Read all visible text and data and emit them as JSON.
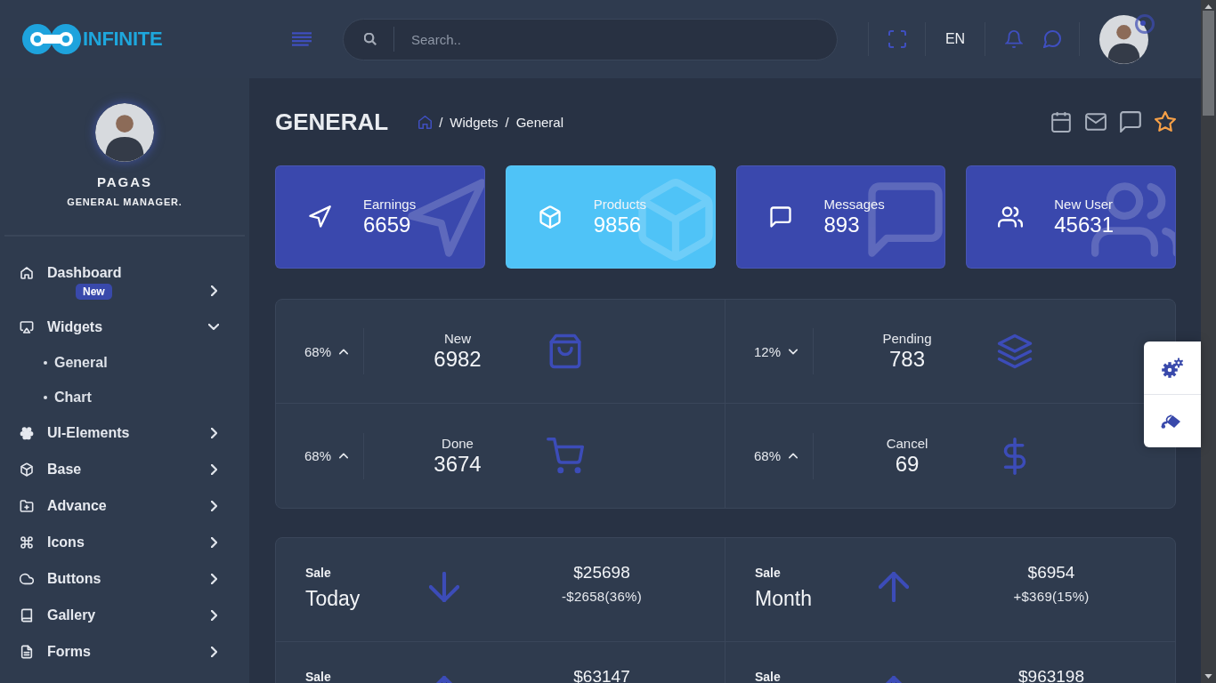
{
  "header": {
    "brand": "INFINITE",
    "search": {
      "placeholder": "Search.."
    },
    "language": "EN"
  },
  "sidebar": {
    "profile": {
      "name": "PAGAS",
      "role": "GENERAL MANAGER."
    },
    "items": [
      {
        "label": "Dashboard",
        "badge": "New",
        "expanded": false
      },
      {
        "label": "Widgets",
        "expanded": true,
        "children": [
          {
            "label": "General"
          },
          {
            "label": "Chart"
          }
        ]
      },
      {
        "label": "UI-Elements",
        "expanded": false
      },
      {
        "label": "Base",
        "expanded": false
      },
      {
        "label": "Advance",
        "expanded": false
      },
      {
        "label": "Icons",
        "expanded": false
      },
      {
        "label": "Buttons",
        "expanded": false
      },
      {
        "label": "Gallery",
        "expanded": false
      },
      {
        "label": "Forms",
        "expanded": false
      }
    ]
  },
  "page": {
    "title": "GENERAL",
    "breadcrumb": [
      {
        "separator": "/",
        "label": "Widgets"
      },
      {
        "separator": "/",
        "label": "General"
      }
    ]
  },
  "stats": [
    {
      "label": "Earnings",
      "value": "6659",
      "color": "#3a48ad"
    },
    {
      "label": "Products",
      "value": "9856",
      "color": "#4fc3f7"
    },
    {
      "label": "Messages",
      "value": "893",
      "color": "#3a48ad"
    },
    {
      "label": "New User",
      "value": "45631",
      "color": "#3a48ad"
    }
  ],
  "orders": [
    {
      "percent": "68%",
      "increase": true,
      "label": "New",
      "value": "6982"
    },
    {
      "percent": "12%",
      "increase": false,
      "label": "Pending",
      "value": "783"
    },
    {
      "percent": "68%",
      "increase": true,
      "label": "Done",
      "value": "3674"
    },
    {
      "percent": "68%",
      "increase": true,
      "label": "Cancel",
      "value": "69"
    }
  ],
  "sales": [
    {
      "label": "Sale",
      "period": "Today",
      "increase": false,
      "amount": "$25698",
      "change": "-$2658(36%)"
    },
    {
      "label": "Sale",
      "period": "Month",
      "increase": true,
      "amount": "$6954",
      "change": "+$369(15%)"
    },
    {
      "label": "Sale",
      "increase": true,
      "amount": "$63147"
    },
    {
      "label": "Sale",
      "increase": true,
      "amount": "$963198"
    }
  ]
}
